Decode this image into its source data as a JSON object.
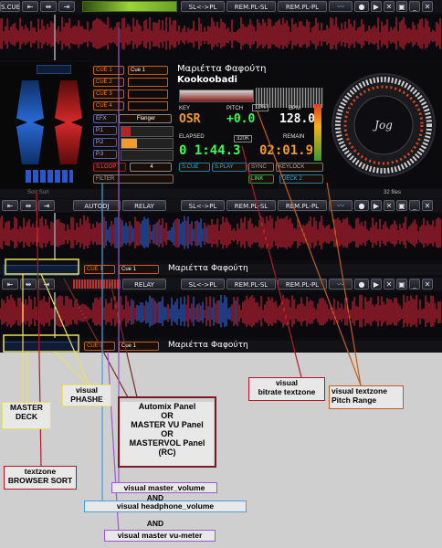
{
  "toolbar_top": {
    "items": [
      "S.CUE",
      "SL<->PL",
      "REM.PL-SL",
      "REM.PL-PL"
    ]
  },
  "toolbar_second": {
    "items": [
      "AUTODJ",
      "RELAY",
      "SL<->PL",
      "REM.PL-SL",
      "REM.PL-PL"
    ],
    "files": "32 files"
  },
  "toolbar_third": {
    "items": [
      "RELAY",
      "SL<->PL",
      "REM.PL-SL",
      "REM.PL-PL"
    ]
  },
  "deck": {
    "cue_buttons": [
      "CUE 1",
      "CUE 2",
      "CUE 3",
      "CUE 4"
    ],
    "cue_selected": "Cue 1",
    "artist": "Μαριέττα Φαφούτη",
    "title": "Kookoobadi",
    "key_label": "KEY",
    "key_value": "OSR",
    "pitch_label": "PITCH",
    "pitch_range": "12%",
    "pitch_value": "+0.0",
    "bpm_label": "BPM",
    "bpm_value": "128.0",
    "elapsed_label": "ELAPSED",
    "elapsed_value": "0 1:44.3",
    "bitrate": "320K",
    "remain_label": "REMAIN",
    "remain_value": "02:01.9",
    "effect_label": "EFX",
    "effect_value": "Flanger",
    "params": [
      "P.1",
      "P.2",
      "P.3"
    ],
    "loop_label": "S.LOOP",
    "loop_value": "4",
    "scue": "S.CUE",
    "splay": "S.PLAY",
    "sync": "SYNC",
    "keylock": "KEYLOCK",
    "filter": "FILTER",
    "link": "LINK",
    "deck2": "DECK 2",
    "jog": "Jog",
    "sort_strip": "Sort Sort"
  },
  "mini_deck_1": {
    "cue_button": "CUE 1",
    "cue_selected": "Cue 1",
    "artist": "Μαριέττα Φαφούτη"
  },
  "mini_deck_2": {
    "cue_button": "CUE 1",
    "cue_selected": "Cue 1",
    "artist": "Μαριέττα Φαφούτη"
  },
  "annotations": {
    "master_deck": "MASTER\nDECK",
    "visual_phashe": "visual\nPHASHE",
    "browser_sort": "textzone\nBROWSER SORT",
    "center_panel": "Automix Panel\nOR\nMASTER VU Panel\nOR\nMASTERVOL Panel\n(RC)",
    "master_volume": "visual master_volume",
    "and1": "AND",
    "headphone_volume": "visual headphone_volume",
    "and2": "AND",
    "vu_meter": "visual master vu-meter",
    "bitrate_zone": "visual\nbitrate textzone",
    "pitch_range_zone": "visual textzone\nPitch Range"
  },
  "colors": {
    "accent_orange": "#f29a2a",
    "digit_green": "#3dfc55",
    "wave_red": "#e8243c",
    "wave_blue": "#3a6cf0",
    "annotation_red": "#a41a22"
  }
}
